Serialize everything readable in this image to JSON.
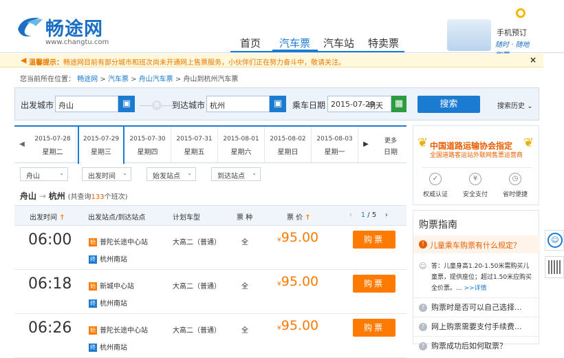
{
  "logo": {
    "name": "畅途网",
    "url": "www.changtu.com"
  },
  "nav": [
    "首页",
    "汽车票",
    "汽车站",
    "特卖票"
  ],
  "promo": {
    "line1": "手机预订",
    "line2": "随时 · 随地购票"
  },
  "notice": {
    "icon": "speaker-icon",
    "label": "温馨提示：",
    "text": "畅途网目前有部分城市和班次尚未开通网上售票服务，小伙伴们正在努力奋斗中，敬请关注。",
    "close": "×"
  },
  "breadcrumb": {
    "prefix": "您当前所在位置：",
    "items": [
      "畅途网",
      "汽车票",
      "舟山汽车票"
    ],
    "current": "舟山到杭州汽车票"
  },
  "search": {
    "from_label": "出发城市",
    "from_value": "舟山",
    "to_label": "到达城市",
    "to_value": "杭州",
    "swap_label": "换",
    "date_label": "乘车日期",
    "date_value": "2015-07-29",
    "weekday": "明天",
    "search_btn": "搜索",
    "history": "搜索历史"
  },
  "date_tabs": [
    {
      "date": "2015-07-28",
      "week": "星期二"
    },
    {
      "date": "2015-07-29",
      "week": "星期三",
      "active": true
    },
    {
      "date": "2015-07-30",
      "week": "星期四"
    },
    {
      "date": "2015-07-31",
      "week": "星期五"
    },
    {
      "date": "2015-08-01",
      "week": "星期六"
    },
    {
      "date": "2015-08-02",
      "week": "星期日"
    },
    {
      "date": "2015-08-03",
      "week": "星期一"
    }
  ],
  "more_dates": {
    "line1": "更多",
    "line2": "日期"
  },
  "filters": {
    "city": "舟山",
    "time": "出发时间",
    "depart_station": "始发站点",
    "arrive_station": "到达站点"
  },
  "route": {
    "from": "舟山",
    "arrow": "→",
    "to": "杭州",
    "count_prefix": "(共查询",
    "count": "133",
    "count_suffix": "个班次)"
  },
  "table": {
    "headers": {
      "time": "出发时间",
      "station": "出发站点/到达站点",
      "bus_type": "计划车型",
      "seat": "票 种",
      "price": "票 价"
    },
    "pager": {
      "current": "1",
      "sep": " / ",
      "total": "5"
    },
    "rows": [
      {
        "time": "06:00",
        "from_tag": "始",
        "from": "普陀长途中心站",
        "to_tag": "终",
        "to": "杭州南站",
        "bus": "大高二（普通）",
        "seat": "全",
        "currency": "¥",
        "price": "95.00",
        "buy": "购票"
      },
      {
        "time": "06:18",
        "from_tag": "始",
        "from": "新城中心站",
        "to_tag": "终",
        "to": "杭州南站",
        "bus": "大高二（普通）",
        "seat": "全",
        "currency": "¥",
        "price": "95.00",
        "buy": "购票"
      },
      {
        "time": "06:26",
        "from_tag": "始",
        "from": "普陀长途中心站",
        "to_tag": "终",
        "to": "杭州南站",
        "bus": "大高二（普通）",
        "seat": "全",
        "currency": "¥",
        "price": "95.00",
        "buy": "购票"
      }
    ]
  },
  "assoc": {
    "title": "中国道路运输协会指定",
    "subtitle": "全国道路客运站外联网售票运营商",
    "features": [
      "权威认证",
      "安全支付",
      "省时便捷"
    ]
  },
  "guide": {
    "title": "购票指南",
    "q1": "儿童乘车购票有什么规定？",
    "answer": "答：儿童身高1.20-1.50米需购买儿童票，提供座位；超过1.50米应购买全价票。...",
    "more": ">>详情",
    "questions": [
      "购票时是否可以自己选择...",
      "网上购票需要支付手续费...",
      "购票成功后如何取票？"
    ]
  }
}
